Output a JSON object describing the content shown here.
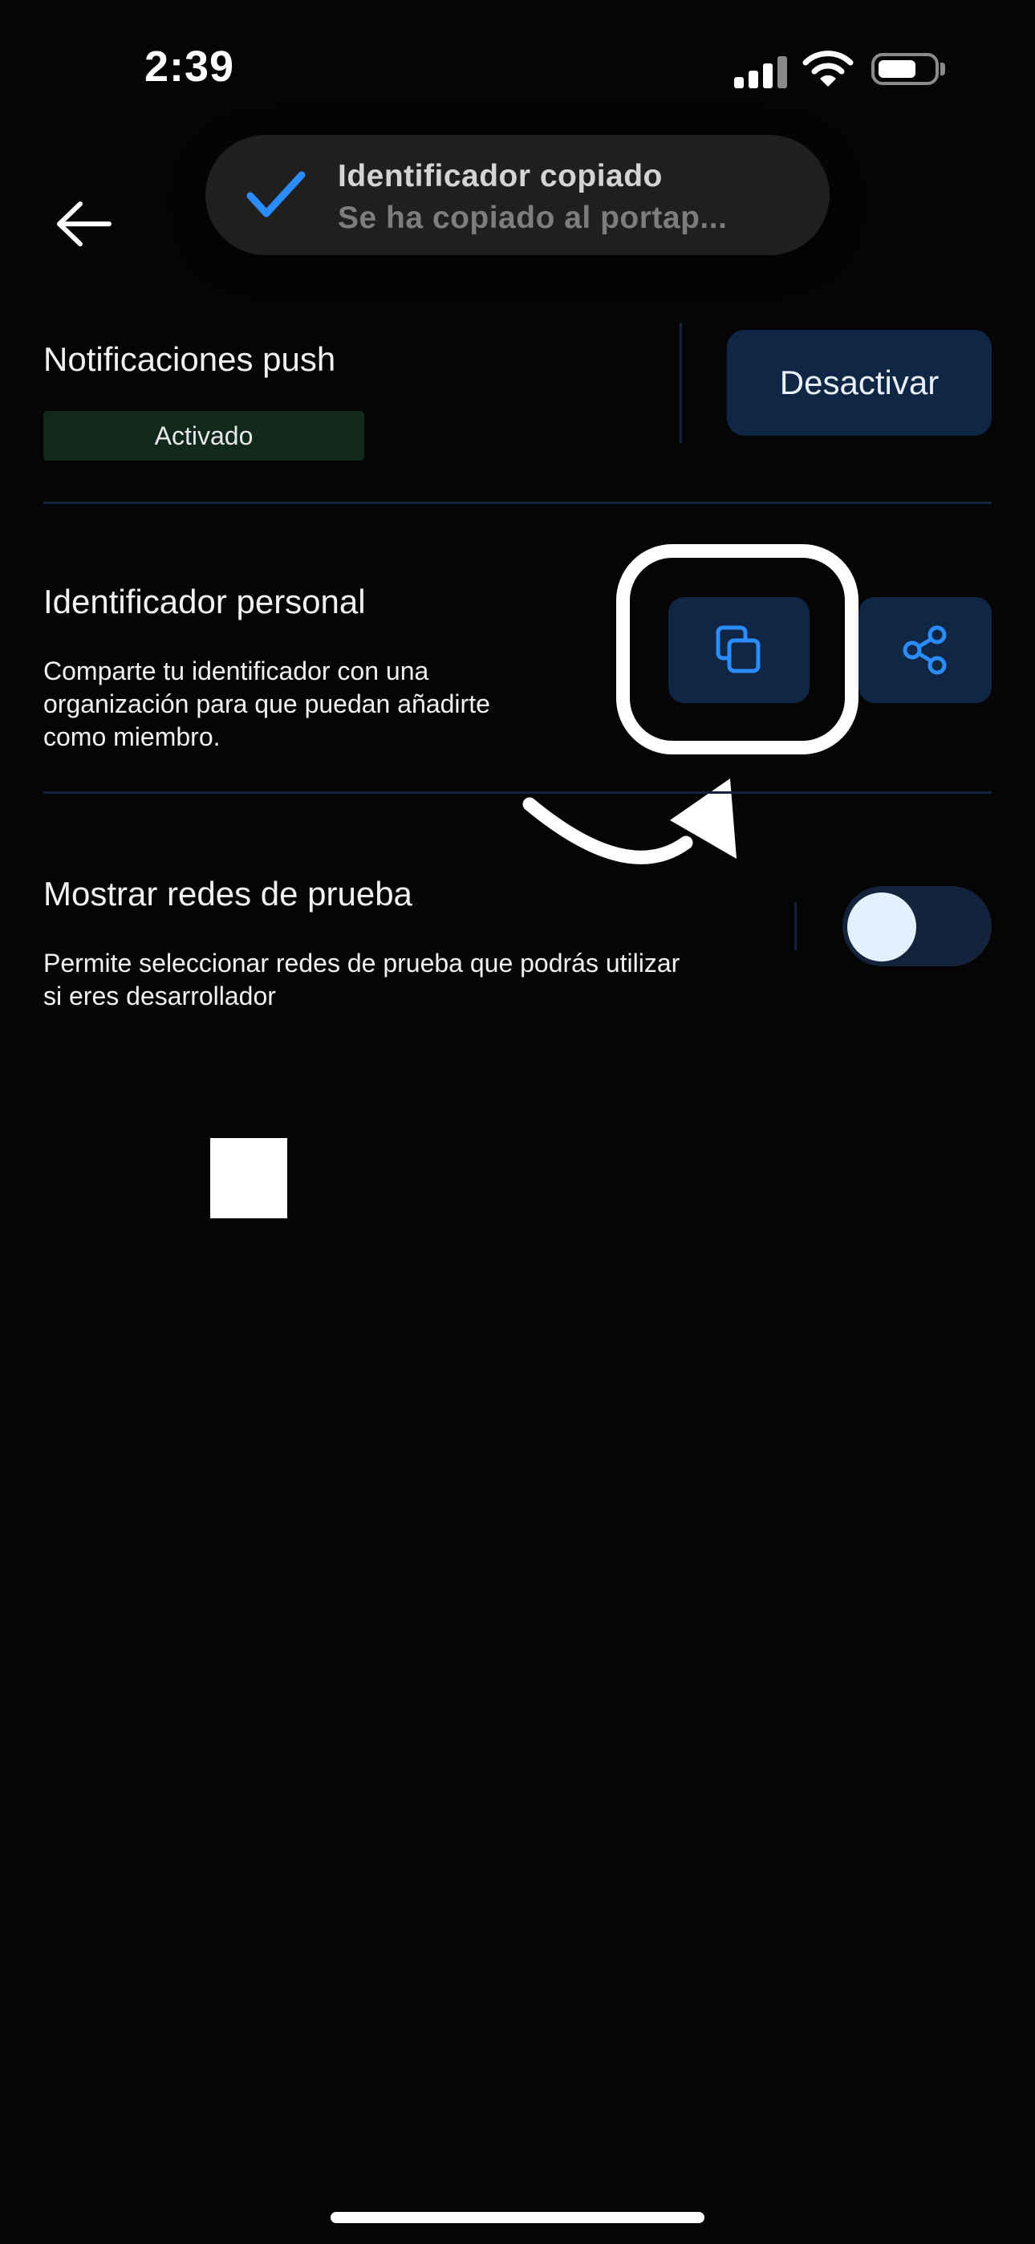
{
  "status_bar": {
    "time": "2:39"
  },
  "toast": {
    "title": "Identificador copiado",
    "subtitle": "Se ha copiado al portap..."
  },
  "notifications": {
    "heading": "Notificaciones push",
    "status_badge": "Activado",
    "action_label": "Desactivar"
  },
  "personal_id": {
    "heading": "Identificador personal",
    "description_lines": [
      "Comparte tu identificador con una",
      "organización para que puedan añadirte",
      "como miembro."
    ]
  },
  "testnets": {
    "heading": "Mostrar redes de prueba",
    "description_lines": [
      "Permite seleccionar redes de prueba que podrás utilizar",
      "si eres desarrollador"
    ],
    "toggle_on": false
  },
  "colors": {
    "background": "#050505",
    "button_bg": "#0f2645",
    "accent_blue": "#2b8cff",
    "divider": "#13233b",
    "badge_bg": "#11281d"
  },
  "icons": {
    "back": "arrow-left-icon",
    "toast": "check-icon",
    "copy": "copy-icon",
    "share": "share-icon"
  }
}
